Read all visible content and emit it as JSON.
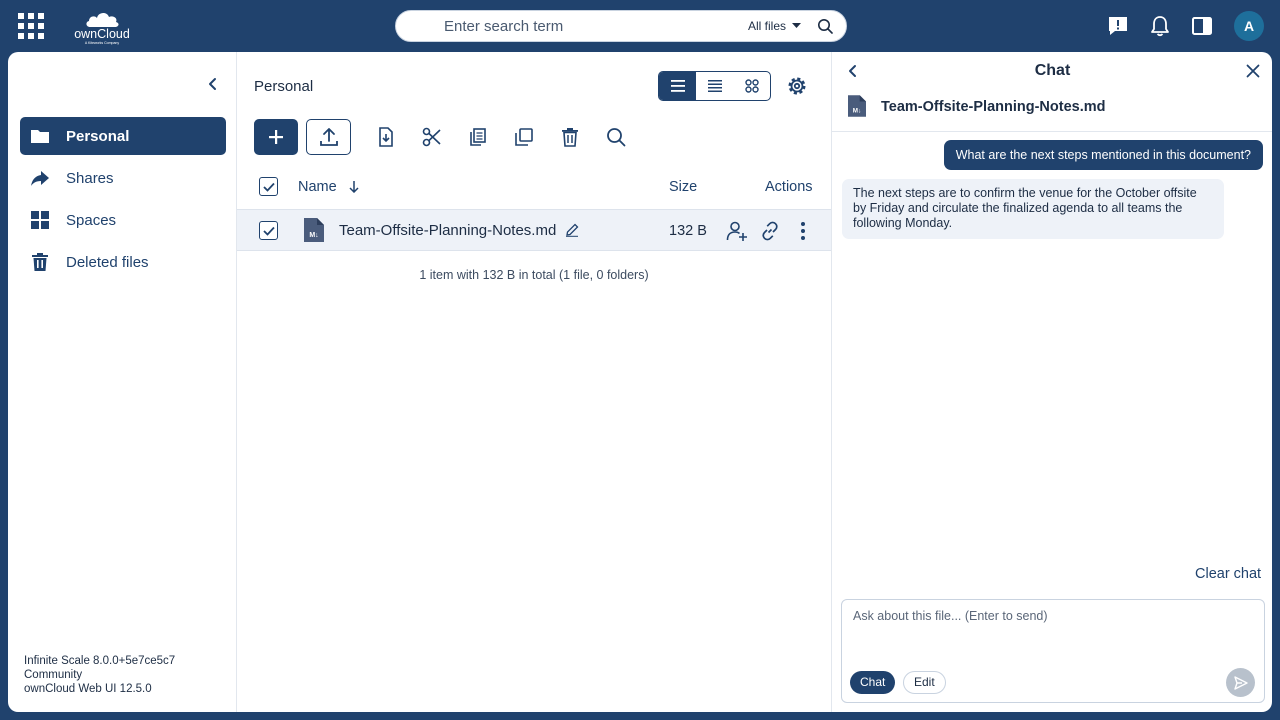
{
  "brand": {
    "name": "ownCloud",
    "tagline": "A Kiteworks Company"
  },
  "search": {
    "placeholder": "Enter search term",
    "filter_label": "All files"
  },
  "user": {
    "avatar_initial": "A"
  },
  "sidebar": {
    "items": [
      {
        "label": "Personal",
        "icon": "folder-icon",
        "active": true
      },
      {
        "label": "Shares",
        "icon": "share-icon",
        "active": false
      },
      {
        "label": "Spaces",
        "icon": "spaces-icon",
        "active": false
      },
      {
        "label": "Deleted files",
        "icon": "trash-icon",
        "active": false
      }
    ],
    "version": {
      "line1": "Infinite Scale 8.0.0+5e7ce5c7",
      "line2": "Community",
      "line3": "ownCloud Web UI 12.5.0"
    }
  },
  "files": {
    "breadcrumb": "Personal",
    "columns": {
      "name": "Name",
      "size": "Size",
      "actions": "Actions"
    },
    "rows": [
      {
        "name": "Team-Offsite-Planning-Notes.md",
        "size": "132 B",
        "selected": true
      }
    ],
    "summary": "1 item with 132 B in total (1 file, 0 folders)"
  },
  "chat": {
    "title": "Chat",
    "file_name": "Team-Offsite-Planning-Notes.md",
    "messages": [
      {
        "role": "user",
        "text": "What are the next steps mentioned in this document?"
      },
      {
        "role": "assistant",
        "text": "The next steps are to confirm the venue for the October offsite by Friday and circulate the finalized agenda to all teams the following Monday."
      }
    ],
    "clear_label": "Clear chat",
    "input_placeholder": "Ask about this file... (Enter to send)",
    "mode_chat": "Chat",
    "mode_edit": "Edit"
  },
  "colors": {
    "primary": "#20426d",
    "row_highlight": "#eef2f8",
    "avatar": "#1e6f9b"
  }
}
